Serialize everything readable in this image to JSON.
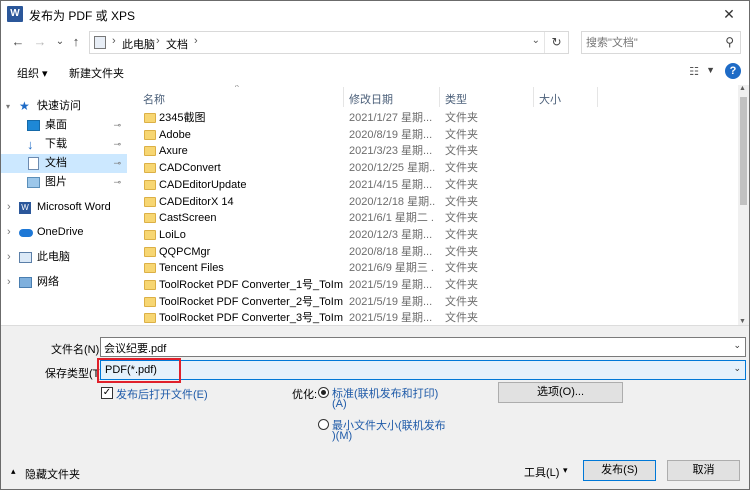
{
  "window": {
    "app_icon_letter": "W",
    "title": "发布为 PDF 或 XPS",
    "close_glyph": "✕"
  },
  "nav": {
    "back": "←",
    "forward": "→",
    "recent": "⌄",
    "up": "↑",
    "breadcrumb": [
      "此电脑",
      "文档"
    ],
    "refresh": "↻",
    "search_placeholder": "搜索\"文档\""
  },
  "toolbar": {
    "organize": "组织 ▾",
    "new_folder": "新建文件夹",
    "view_glyph": "☷",
    "help": "?"
  },
  "sidebar": {
    "items": [
      {
        "label": "快速访问",
        "icon": "star-icon",
        "expand": "▾",
        "pinned": false
      },
      {
        "label": "桌面",
        "icon": "desktop-icon",
        "expand": "",
        "pinned": true
      },
      {
        "label": "下载",
        "icon": "download-icon",
        "expand": "",
        "pinned": true
      },
      {
        "label": "文档",
        "icon": "document-icon",
        "expand": "",
        "pinned": true,
        "selected": true
      },
      {
        "label": "图片",
        "icon": "picture-icon",
        "expand": "",
        "pinned": true
      },
      {
        "label": "Microsoft Word",
        "icon": "word-icon",
        "expand": "›",
        "pinned": false
      },
      {
        "label": "OneDrive",
        "icon": "onedrive-icon",
        "expand": "›",
        "pinned": false
      },
      {
        "label": "此电脑",
        "icon": "computer-icon",
        "expand": "›",
        "pinned": false
      },
      {
        "label": "网络",
        "icon": "network-icon",
        "expand": "›",
        "pinned": false
      }
    ],
    "pin_glyph": "📌"
  },
  "file_list": {
    "columns": [
      "名称",
      "修改日期",
      "类型",
      "大小"
    ],
    "rows": [
      {
        "name": "2345截图",
        "date": "2021/1/27 星期...",
        "type": "文件夹"
      },
      {
        "name": "Adobe",
        "date": "2020/8/19 星期...",
        "type": "文件夹"
      },
      {
        "name": "Axure",
        "date": "2021/3/23 星期...",
        "type": "文件夹"
      },
      {
        "name": "CADConvert",
        "date": "2020/12/25 星期...",
        "type": "文件夹"
      },
      {
        "name": "CADEditorUpdate",
        "date": "2021/4/15 星期...",
        "type": "文件夹"
      },
      {
        "name": "CADEditorX 14",
        "date": "2020/12/18 星期...",
        "type": "文件夹"
      },
      {
        "name": "CastScreen",
        "date": "2021/6/1 星期二 ...",
        "type": "文件夹"
      },
      {
        "name": "LoiLo",
        "date": "2020/12/3 星期...",
        "type": "文件夹"
      },
      {
        "name": "QQPCMgr",
        "date": "2020/8/18 星期...",
        "type": "文件夹"
      },
      {
        "name": "Tencent Files",
        "date": "2021/6/9 星期三 ...",
        "type": "文件夹"
      },
      {
        "name": "ToolRocket PDF Converter_1号_ToIm...",
        "date": "2021/5/19 星期...",
        "type": "文件夹"
      },
      {
        "name": "ToolRocket PDF Converter_2号_ToIm...",
        "date": "2021/5/19 星期...",
        "type": "文件夹"
      },
      {
        "name": "ToolRocket PDF Converter_3号_ToIm...",
        "date": "2021/5/19 星期...",
        "type": "文件夹"
      }
    ]
  },
  "form": {
    "filename_label": "文件名(N):",
    "filename_value": "会议纪要.pdf",
    "filetype_label": "保存类型(T):",
    "filetype_value": "PDF(*.pdf)",
    "open_after_publish": "发布后打开文件(E)",
    "optimize_label": "优化:",
    "opt_standard_line1": "标准(联机发布和打印)",
    "opt_standard_line2": "(A)",
    "opt_min_line1": "最小文件大小(联机发布",
    "opt_min_line2": ")(M)",
    "options_button": "选项(O)...",
    "hide_folders": "隐藏文件夹",
    "hide_glyph": "▴",
    "tools": "工具(L)",
    "tools_dd": "▾",
    "publish": "发布(S)",
    "cancel": "取消",
    "check_glyph": "✓",
    "dd_glyph": "⌄"
  }
}
